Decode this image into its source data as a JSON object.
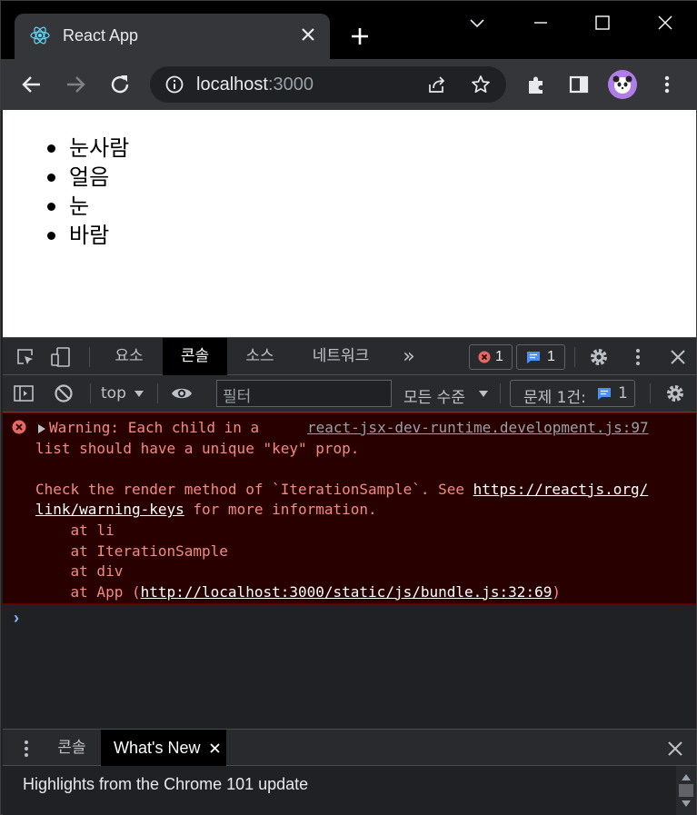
{
  "browser": {
    "tab_title": "React App",
    "url_host": "localhost",
    "url_port": ":3000"
  },
  "page": {
    "items": [
      "눈사람",
      "얼음",
      "눈",
      "바람"
    ]
  },
  "devtools": {
    "tabs": [
      "요소",
      "콘솔",
      "소스",
      "네트워크"
    ],
    "active_tab": "콘솔",
    "more": "»",
    "error_count": "1",
    "message_count": "1",
    "context": "top",
    "filter_placeholder": "필터",
    "levels": "모든 수준",
    "issues_label": "문제 1건:",
    "issues_count": "1"
  },
  "console": {
    "warning_line1": "Warning: Each child in a",
    "source_link": "react-jsx-dev-runtime.development.js:97",
    "warning_line2": "list should have a unique \"key\" prop.",
    "check_prefix": "Check the render method of `IterationSample`. See ",
    "link1a": "https://reactjs.org/",
    "link1b": "link/warning-keys",
    "more_info": " for more information.",
    "stack1": "    at li",
    "stack2": "    at IterationSample",
    "stack3": "    at div",
    "stack4_prefix": "    at App (",
    "stack4_link": "http://localhost:3000/static/js/bundle.js:32:69",
    "stack4_suffix": ")",
    "prompt": "›"
  },
  "drawer": {
    "tabs": [
      "콘솔",
      "What's New"
    ],
    "active_tab": "What's New",
    "message": "Highlights from the Chrome 101 update"
  },
  "colors": {
    "error_text": "#f28b82",
    "error_bg": "#290000",
    "accent": "#8ab4f8"
  }
}
